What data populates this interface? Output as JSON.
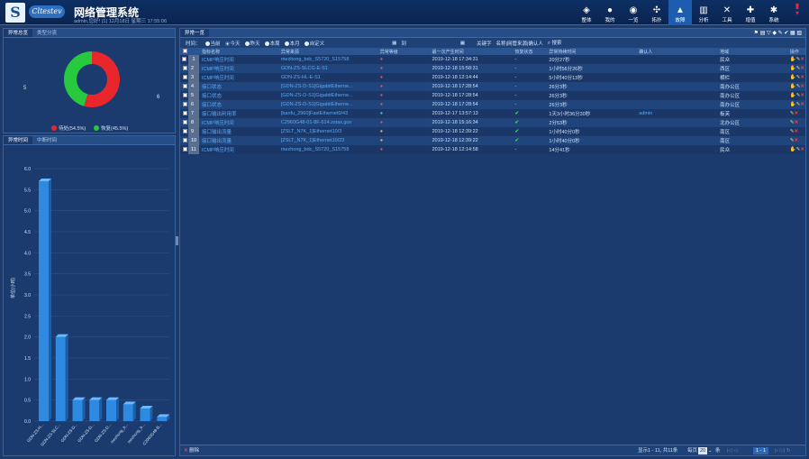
{
  "header": {
    "logo_glyph": "S",
    "brand": "Cltestev",
    "title": "网络管理系统",
    "subtitle": "admin,您好! (1) 12月18日 星期三 17:55:06",
    "nav": [
      {
        "icon": "layers-icon",
        "glyph": "◈",
        "label": "整体"
      },
      {
        "icon": "user-icon",
        "glyph": "●",
        "label": "我的"
      },
      {
        "icon": "target-icon",
        "glyph": "◉",
        "label": "一览"
      },
      {
        "icon": "topology-icon",
        "glyph": "✣",
        "label": "拓扑"
      },
      {
        "icon": "warning-icon",
        "glyph": "▲",
        "label": "故障",
        "active": true
      },
      {
        "icon": "chart-icon",
        "glyph": "▥",
        "label": "分析"
      },
      {
        "icon": "tools-icon",
        "glyph": "✕",
        "label": "工具"
      },
      {
        "icon": "plus-icon",
        "glyph": "✚",
        "label": "增值"
      },
      {
        "icon": "gear-icon",
        "glyph": "✱",
        "label": "系统"
      }
    ]
  },
  "left_top": {
    "tabs": [
      "异常总览",
      "类型分流"
    ],
    "chart_data": {
      "type": "pie",
      "title": "",
      "series": [
        {
          "name": "待处",
          "value": 54.5,
          "color": "#e8262c"
        },
        {
          "name": "恢复",
          "value": 45.5,
          "color": "#27c93f"
        }
      ],
      "labels": {
        "left": "5",
        "right": "6"
      }
    },
    "legend": [
      "待处(54.5%)",
      "恢复(45.5%)"
    ]
  },
  "left_bottom": {
    "tabs": [
      "异常时间",
      "中断时间"
    ],
    "chart_data": {
      "type": "bar",
      "title": "",
      "ylabel": "单位(小时)",
      "ylim": [
        0,
        6
      ],
      "yticks": [
        "0.0",
        "0.5",
        "1.0",
        "1.5",
        "2.0",
        "2.5",
        "3.0",
        "3.5",
        "4.0",
        "4.5",
        "5.0",
        "5.5",
        "6.0"
      ],
      "categories": [
        "GDN-ZS-H...",
        "GDN-ZS-SLC...",
        "GDN-ZS-D...",
        "GDN-ZS-D...",
        "GDN-ZS-D...",
        "mezhong_b...",
        "mezhong_b...",
        "C2960G48-B..."
      ],
      "values": [
        5.7,
        2.0,
        0.5,
        0.5,
        0.5,
        0.4,
        0.3,
        0.1
      ]
    }
  },
  "main": {
    "tab": "异常一览",
    "filter": {
      "time_label": "时间：",
      "options": [
        "当前",
        "今天",
        "昨天",
        "本周",
        "本月",
        "自定义"
      ],
      "active": 1,
      "to": "到",
      "keyword_label": "关键字",
      "keyword_placeholder": "名称|网管来源|确认人",
      "search": "搜索"
    },
    "columns": [
      "",
      "",
      "指标名称",
      "异常来源",
      "异常等级",
      "最一次产生时间",
      "恢复状态",
      "异常持续时间",
      "确认人",
      "地域",
      "操作"
    ],
    "rows": [
      {
        "n": "1",
        "name": "ICMP响应时间",
        "src": "mezhong_bdc_S5720_S15758",
        "lv": "r",
        "time": "2019-12-18 17:34:31",
        "st": "-",
        "dur": "20分27秒",
        "who": "",
        "area": "民众",
        "sel": true
      },
      {
        "n": "2",
        "name": "ICMP响应时间",
        "src": "GDN-ZS-SLCG-E-S1",
        "lv": "r",
        "time": "2019-12-18 15:58:31",
        "st": "-",
        "dur": "1小时56分26秒",
        "who": "",
        "area": "西区"
      },
      {
        "n": "3",
        "name": "ICMP响应时间",
        "src": "GDN-ZS-HL-E-S1",
        "lv": "r",
        "time": "2019-12-18 12:14:44",
        "st": "-",
        "dur": "5小时40分13秒",
        "who": "",
        "area": "横栏"
      },
      {
        "n": "4",
        "name": "接口状态",
        "src": "[GDN-ZS-D-S1]GigabitEtherne...",
        "lv": "r",
        "time": "2019-12-18 17:28:54",
        "st": "-",
        "dur": "26分3秒",
        "who": "",
        "area": "南办公区"
      },
      {
        "n": "5",
        "name": "接口状态",
        "src": "[GDN-ZS-D-S1]GigabitEtherne...",
        "lv": "r",
        "time": "2019-12-18 17:28:54",
        "st": "-",
        "dur": "26分3秒",
        "who": "",
        "area": "南办公区"
      },
      {
        "n": "6",
        "name": "接口状态",
        "src": "[GDN-ZS-D-S1]GigabitEtherne...",
        "lv": "r",
        "time": "2019-12-18 17:28:54",
        "st": "-",
        "dur": "26分3秒",
        "who": "",
        "area": "南办公区"
      },
      {
        "n": "7",
        "name": "接口输出利用率",
        "src": "[banfu_2960]FastEthernet0/43",
        "lv": "g",
        "time": "2019-12-17 13:57:13",
        "st": "ok",
        "dur": "1天3小时36分30秒",
        "who": "admin",
        "area": "板芙"
      },
      {
        "n": "8",
        "name": "ICMP响应时间",
        "src": "C2960G48-01-8F-614.zstax.gov",
        "lv": "r",
        "time": "2019-12-18 15:16:34",
        "st": "ok",
        "dur": "2分53秒",
        "who": "",
        "area": "北办公区"
      },
      {
        "n": "9",
        "name": "接口输出流量",
        "src": "[ZSLT_N7K_1]Ethernet10/3",
        "lv": "y",
        "time": "2019-12-18 12:39:22",
        "st": "ok",
        "dur": "1小时40分0秒",
        "who": "",
        "area": "南区"
      },
      {
        "n": "10",
        "name": "接口输出流量",
        "src": "[ZSLT_N7K_1]Ethernet10/23",
        "lv": "y",
        "time": "2019-12-18 12:39:22",
        "st": "ok",
        "dur": "1小时40分0秒",
        "who": "",
        "area": "南区"
      },
      {
        "n": "11",
        "name": "ICMP响应时间",
        "src": "mezhong_bdc_S5720_S15758",
        "lv": "r",
        "time": "2019-12-18 12:14:58",
        "st": "-",
        "dur": "14分41秒",
        "who": "",
        "area": "民众"
      }
    ],
    "footer": {
      "delete": "删除",
      "summary": "显示1 - 11, 共11条",
      "per_page_label": "每页",
      "per_page": "20",
      "per_page_unit": "条",
      "page": "1 - 1"
    }
  }
}
